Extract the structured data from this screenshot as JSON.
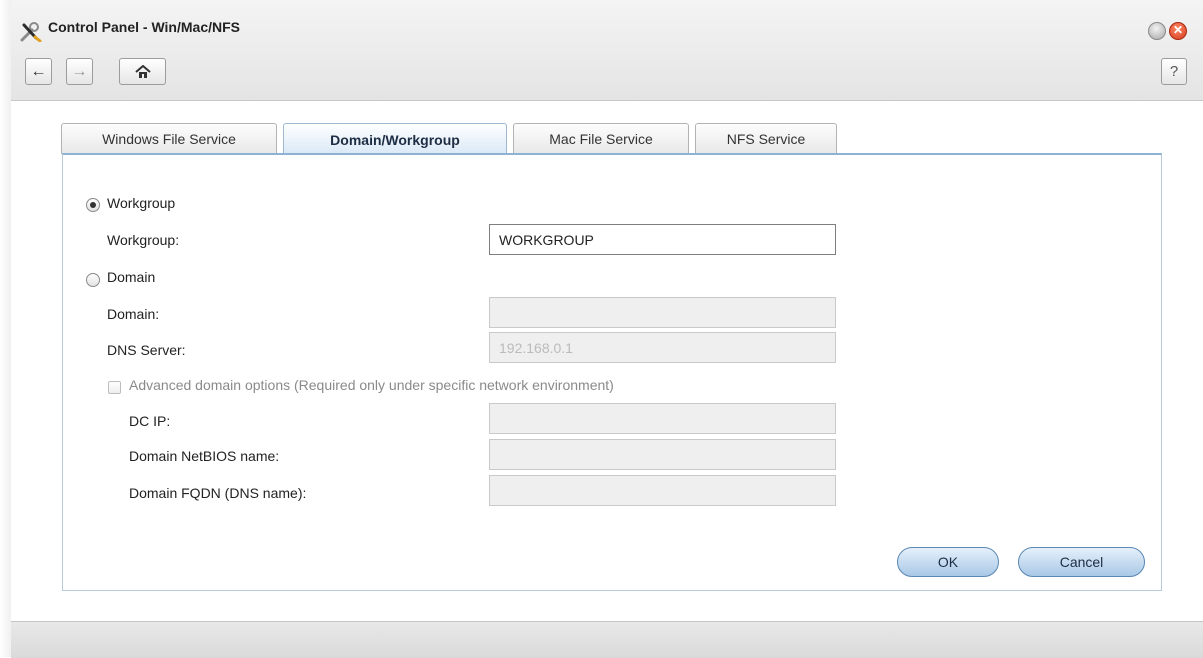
{
  "window": {
    "title": "Control Panel - Win/Mac/NFS",
    "app_icon": "wrench-screwdriver-icon"
  },
  "toolbar": {
    "back_icon": "arrow-left-icon",
    "forward_icon": "arrow-right-icon",
    "home_icon": "home-icon",
    "help_label": "?"
  },
  "tabs": [
    {
      "label": "Windows File Service",
      "active": false
    },
    {
      "label": "Domain/Workgroup",
      "active": true
    },
    {
      "label": "Mac File Service",
      "active": false
    },
    {
      "label": "NFS Service",
      "active": false
    }
  ],
  "form": {
    "workgroup_radio": {
      "label": "Workgroup",
      "checked": true
    },
    "workgroup_field": {
      "label": "Workgroup:",
      "value": "WORKGROUP"
    },
    "domain_radio": {
      "label": "Domain",
      "checked": false
    },
    "domain_field": {
      "label": "Domain:",
      "value": ""
    },
    "dns_field": {
      "label": "DNS Server:",
      "placeholder": "192.168.0.1"
    },
    "advanced_checkbox": {
      "label": "Advanced domain options (Required only under specific network environment)",
      "checked": false
    },
    "dc_ip_field": {
      "label": "DC IP:",
      "value": ""
    },
    "netbios_field": {
      "label": "Domain NetBIOS name:",
      "value": ""
    },
    "fqdn_field": {
      "label": "Domain FQDN (DNS name):",
      "value": ""
    }
  },
  "buttons": {
    "ok_label": "OK",
    "cancel_label": "Cancel"
  },
  "colors": {
    "accent": "#8fb1d3",
    "button_fill": "#a9c8e7",
    "close_button": "#d33a1a"
  }
}
